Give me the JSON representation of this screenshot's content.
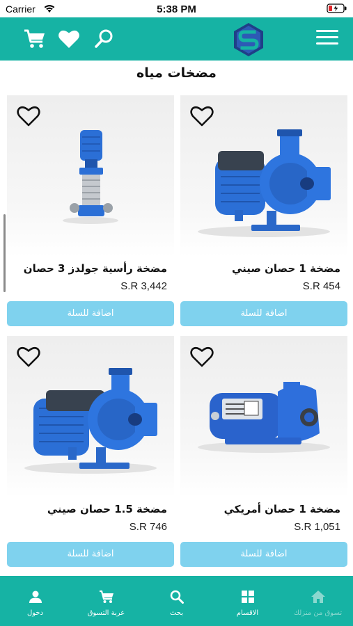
{
  "status_bar": {
    "carrier": "Carrier",
    "time": "5:38 PM"
  },
  "header": {
    "logo": "S"
  },
  "page": {
    "title": "مضخات مياه"
  },
  "products": [
    {
      "name": "مضخة 1 حصان صيني",
      "price": "S.R 454",
      "add_label": "اضافة للسلة",
      "image": "blue-centrifugal-pump"
    },
    {
      "name": "مضخة رأسية جولدز 3 حصان",
      "price": "S.R 3,442",
      "add_label": "اضافة للسلة",
      "image": "vertical-multistage-pump"
    },
    {
      "name": "مضخة 1 حصان أمريكي",
      "price": "S.R 1,051",
      "add_label": "اضافة للسلة",
      "image": "blue-labeled-pump"
    },
    {
      "name": "مضخة 1.5 حصان صيني",
      "price": "S.R 746",
      "add_label": "اضافة للسلة",
      "image": "blue-centrifugal-pump"
    }
  ],
  "tabbar": {
    "items": [
      {
        "label": "تسوق من منزلك",
        "icon": "home-icon",
        "active": true
      },
      {
        "label": "الاقسام",
        "icon": "grid-icon"
      },
      {
        "label": "بحث",
        "icon": "search-icon"
      },
      {
        "label": "عربة التسوق",
        "icon": "cart-icon"
      },
      {
        "label": "دخول",
        "icon": "person-icon"
      }
    ]
  },
  "colors": {
    "brand": "#16b3a4",
    "button": "#7fd2ee",
    "pump_blue": "#2b6fd6"
  }
}
